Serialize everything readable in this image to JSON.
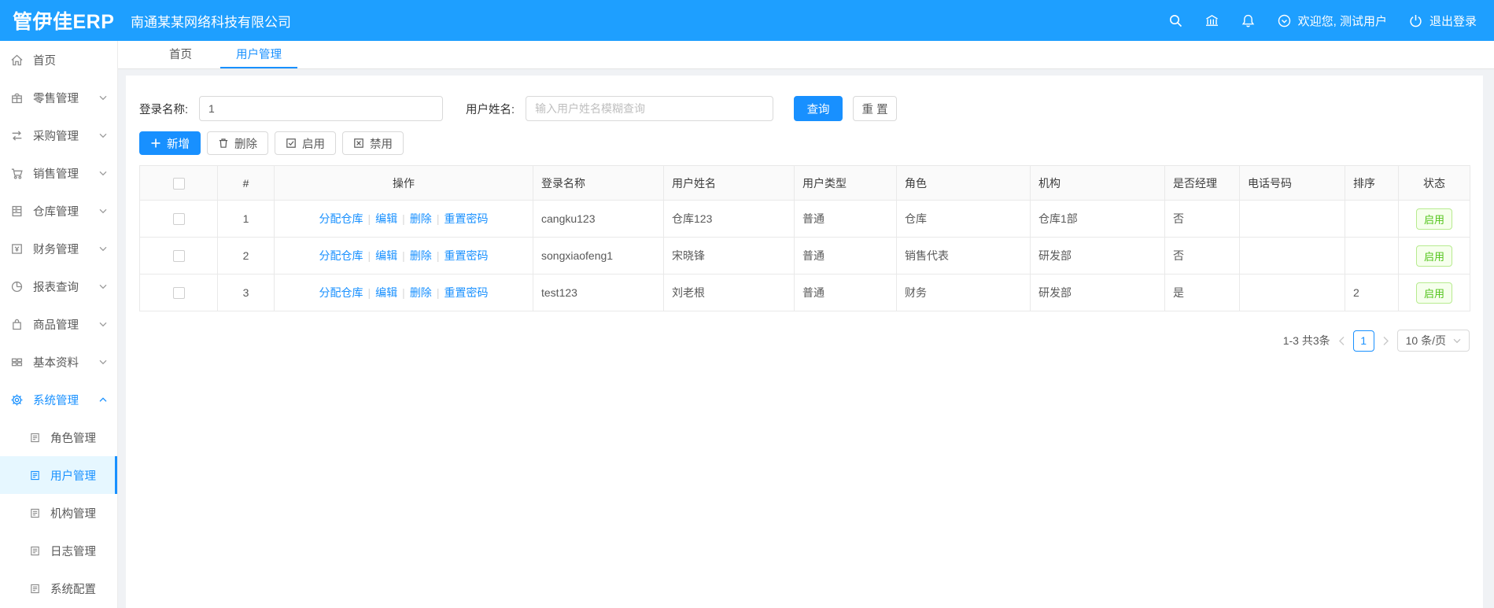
{
  "header": {
    "logo": "管伊佳ERP",
    "company": "南通某某网络科技有限公司",
    "welcome": "欢迎您, 测试用户",
    "logout": "退出登录",
    "icons": [
      "search-icon",
      "bank-icon",
      "bell-icon",
      "user-circle-icon",
      "power-icon"
    ]
  },
  "sidebar": {
    "items": [
      {
        "label": "首页",
        "icon": "home-icon"
      },
      {
        "label": "零售管理",
        "icon": "retail-icon"
      },
      {
        "label": "采购管理",
        "icon": "purchase-icon"
      },
      {
        "label": "销售管理",
        "icon": "sales-cart-icon"
      },
      {
        "label": "仓库管理",
        "icon": "warehouse-icon"
      },
      {
        "label": "财务管理",
        "icon": "finance-icon"
      },
      {
        "label": "报表查询",
        "icon": "report-pie-icon"
      },
      {
        "label": "商品管理",
        "icon": "goods-bag-icon"
      },
      {
        "label": "基本资料",
        "icon": "basic-data-icon"
      },
      {
        "label": "系统管理",
        "icon": "gear-icon",
        "expanded": true,
        "children": [
          {
            "label": "角色管理",
            "icon": "doc-icon"
          },
          {
            "label": "用户管理",
            "icon": "doc-icon",
            "active": true
          },
          {
            "label": "机构管理",
            "icon": "doc-icon"
          },
          {
            "label": "日志管理",
            "icon": "doc-icon"
          },
          {
            "label": "系统配置",
            "icon": "doc-icon"
          }
        ]
      }
    ]
  },
  "tabs": {
    "items": [
      {
        "label": "首页"
      },
      {
        "label": "用户管理",
        "active": true
      }
    ]
  },
  "search": {
    "login_label": "登录名称:",
    "login_value": "1",
    "name_label": "用户姓名:",
    "name_placeholder": "输入用户姓名模糊查询",
    "query_label": "查询",
    "reset_label": "重 置"
  },
  "toolbar": {
    "add_label": "新增",
    "delete_label": "删除",
    "enable_label": "启用",
    "disable_label": "禁用"
  },
  "table": {
    "columns": {
      "index": "#",
      "op": "操作",
      "login": "登录名称",
      "name": "用户姓名",
      "type": "用户类型",
      "role": "角色",
      "org": "机构",
      "manager": "是否经理",
      "phone": "电话号码",
      "sort": "排序",
      "status": "状态"
    },
    "op_links": [
      "分配仓库",
      "编辑",
      "删除",
      "重置密码"
    ],
    "rows": [
      {
        "index": "1",
        "login": "cangku123",
        "name": "仓库123",
        "type": "普通",
        "role": "仓库",
        "org": "仓库1部",
        "manager": "否",
        "phone": "",
        "sort": "",
        "status": "启用"
      },
      {
        "index": "2",
        "login": "songxiaofeng1",
        "name": "宋晓锋",
        "type": "普通",
        "role": "销售代表",
        "org": "研发部",
        "manager": "否",
        "phone": "",
        "sort": "",
        "status": "启用"
      },
      {
        "index": "3",
        "login": "test123",
        "name": "刘老根",
        "type": "普通",
        "role": "财务",
        "org": "研发部",
        "manager": "是",
        "phone": "",
        "sort": "2",
        "status": "启用"
      }
    ]
  },
  "pagination": {
    "total_text": "1-3 共3条",
    "current_page": "1",
    "page_size": "10 条/页"
  },
  "colors": {
    "header_bg": "#1E9FFF",
    "primary": "#1890ff",
    "active_menu_bg": "#e6f7ff",
    "status_green": "#52c41a",
    "status_green_border": "#b7eb8f",
    "status_green_bg": "#f6ffed",
    "table_header_bg": "#fafafa",
    "border": "#e9e9e9"
  }
}
